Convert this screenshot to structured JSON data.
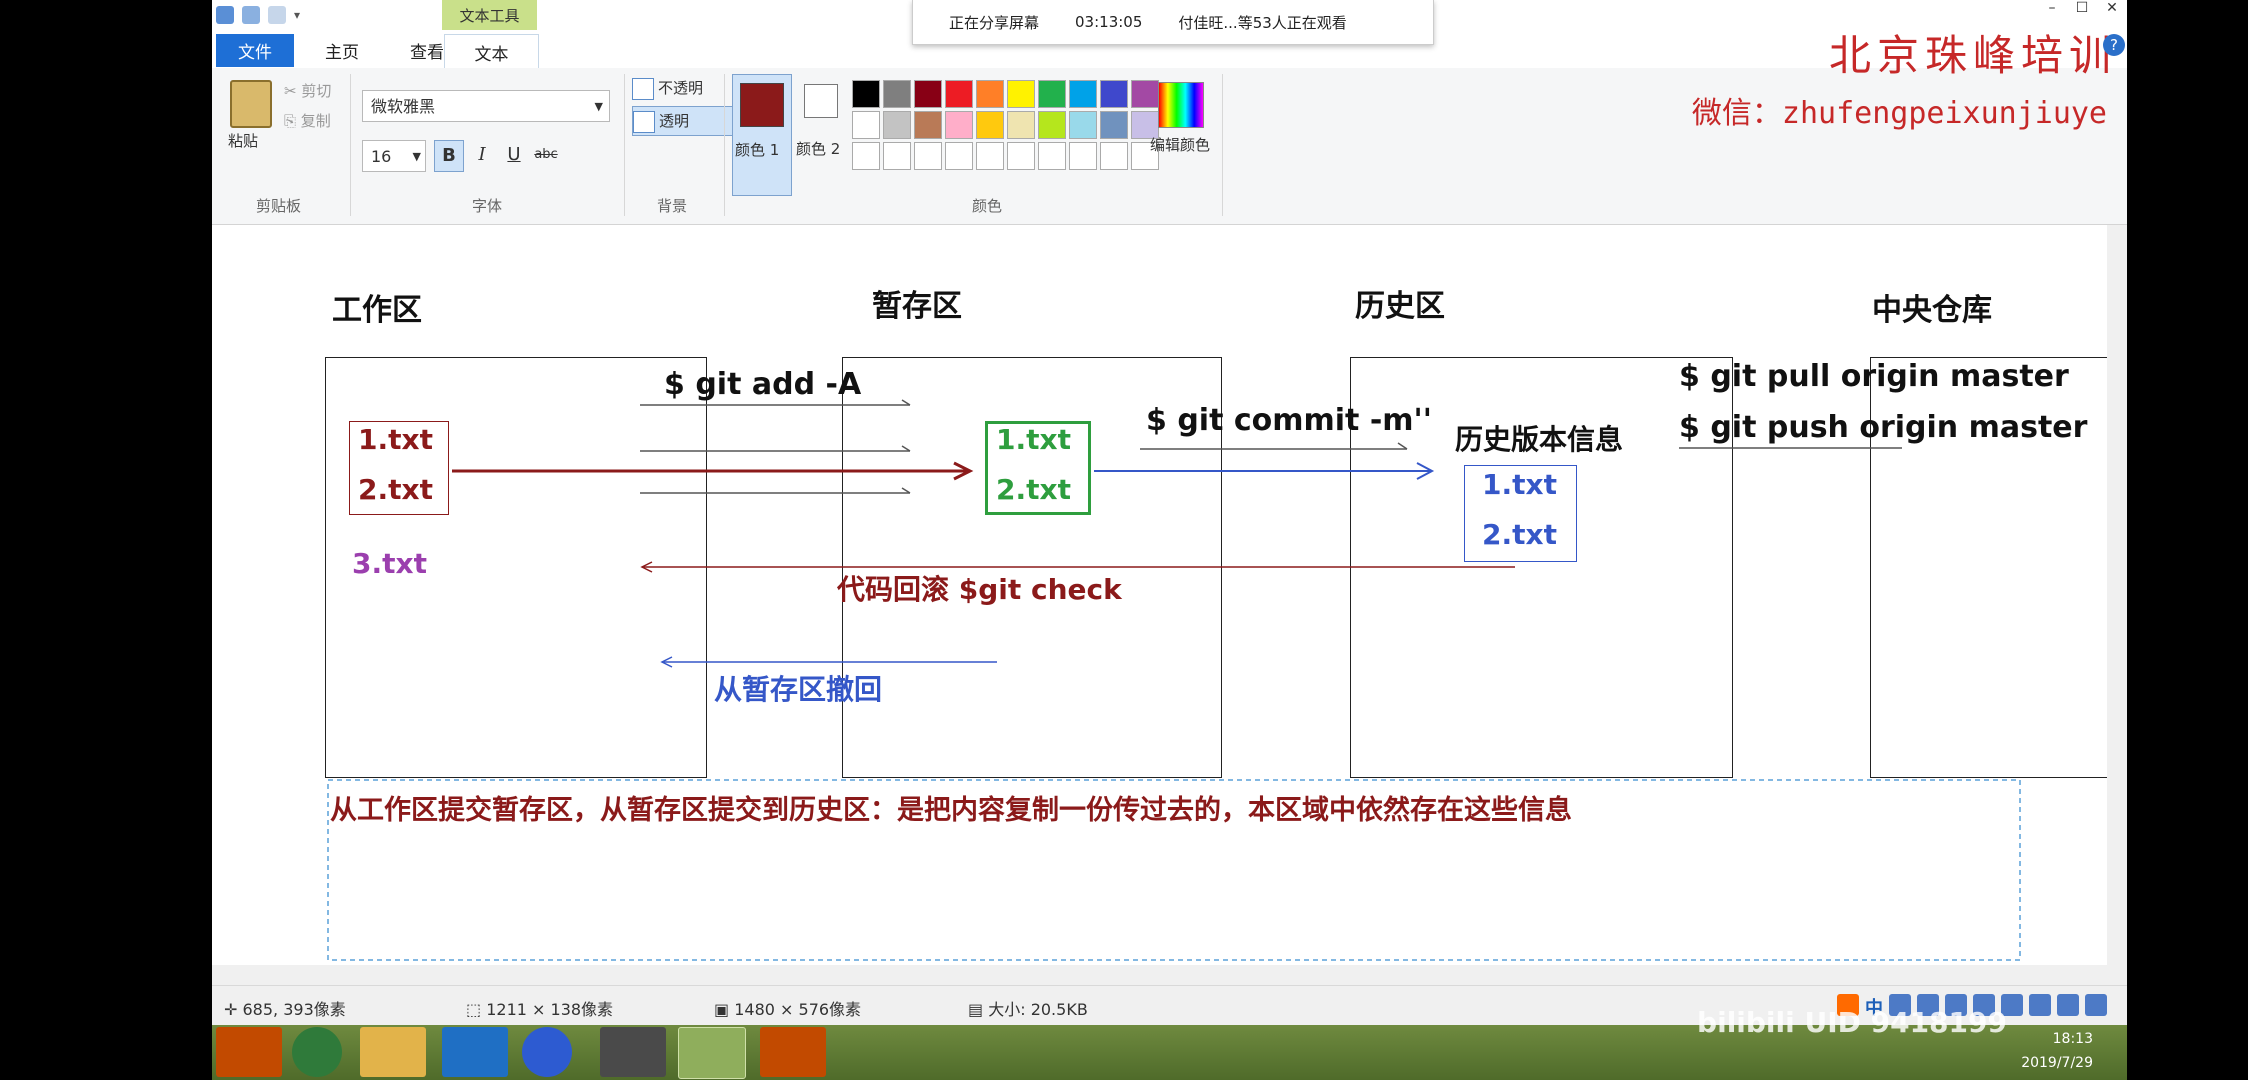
{
  "window": {
    "context_tab": "文本工具",
    "minimize": "–",
    "maximize": "☐",
    "close": "✕"
  },
  "share_bar": {
    "status": "正在分享屏幕",
    "time": "03:13:05",
    "viewers": "付佳旺...等53人正在观看"
  },
  "tabs": {
    "file": "文件",
    "home": "主页",
    "view": "查看",
    "text": "文本"
  },
  "watermark": {
    "brand": "北京珠峰培训",
    "wechat": "微信：zhufengpeixunjiuye"
  },
  "ribbon": {
    "clipboard": {
      "paste": "粘贴",
      "cut": "剪切",
      "copy": "复制",
      "group": "剪贴板"
    },
    "font": {
      "family": "微软雅黑",
      "size": "16",
      "bold": "B",
      "italic": "I",
      "underline": "U",
      "strike": "abc",
      "group": "字体"
    },
    "background": {
      "opaque": "不透明",
      "transparent": "透明",
      "group": "背景"
    },
    "colors": {
      "color1": "颜色 1",
      "color2": "颜色 2",
      "edit": "编辑颜色",
      "group": "颜色",
      "palette": [
        "#000000",
        "#7f7f7f",
        "#880015",
        "#ed1c24",
        "#ff7f27",
        "#fff200",
        "#22b14c",
        "#00a2e8",
        "#3f48cc",
        "#a349a4",
        "#ffffff",
        "#c3c3c3",
        "#b97a57",
        "#ffaec9",
        "#ffc90e",
        "#efe4b0",
        "#b5e61d",
        "#99d9ea",
        "#7092be",
        "#c8bfe7",
        "#ffffff",
        "#ffffff",
        "#ffffff",
        "#ffffff",
        "#ffffff",
        "#ffffff",
        "#ffffff",
        "#ffffff",
        "#ffffff",
        "#ffffff"
      ]
    }
  },
  "canvas": {
    "areas": {
      "work": "工作区",
      "stage": "暂存区",
      "history": "历史区",
      "remote": "中央仓库"
    },
    "cmd_add": "$ git add -A",
    "cmd_commit": "$ git commit -m''",
    "cmd_pull": "$ git pull origin master",
    "cmd_push": "$ git push origin master",
    "history_info": "历史版本信息",
    "work_files": [
      "1.txt",
      "2.txt"
    ],
    "work_untracked": "3.txt",
    "stage_files": [
      "1.txt",
      "2.txt"
    ],
    "history_files": [
      "1.txt",
      "2.txt"
    ],
    "rollback": "代码回滚  $git check",
    "unstage": "从暂存区撤回",
    "note": "从工作区提交暂存区，从暂存区提交到历史区：是把内容复制一份传过去的，本区域中依然存在这些信息"
  },
  "statusbar": {
    "cursor": "685, 393像素",
    "selection": "1211 × 138像素",
    "canvas_size": "1480 × 576像素",
    "file_size": "大小: 20.5KB"
  },
  "tray": {
    "bilibili": "bilibili UID 9418199",
    "time": "18:13",
    "date": "2019/7/29",
    "ime": "中"
  },
  "colors": {
    "work_file": "#8b1a1a",
    "stage_file": "#2e9e3e",
    "history_file": "#3557c8",
    "untracked": "#9b3fae",
    "rollback": "#8b1a1a",
    "unstage": "#3557c8"
  }
}
